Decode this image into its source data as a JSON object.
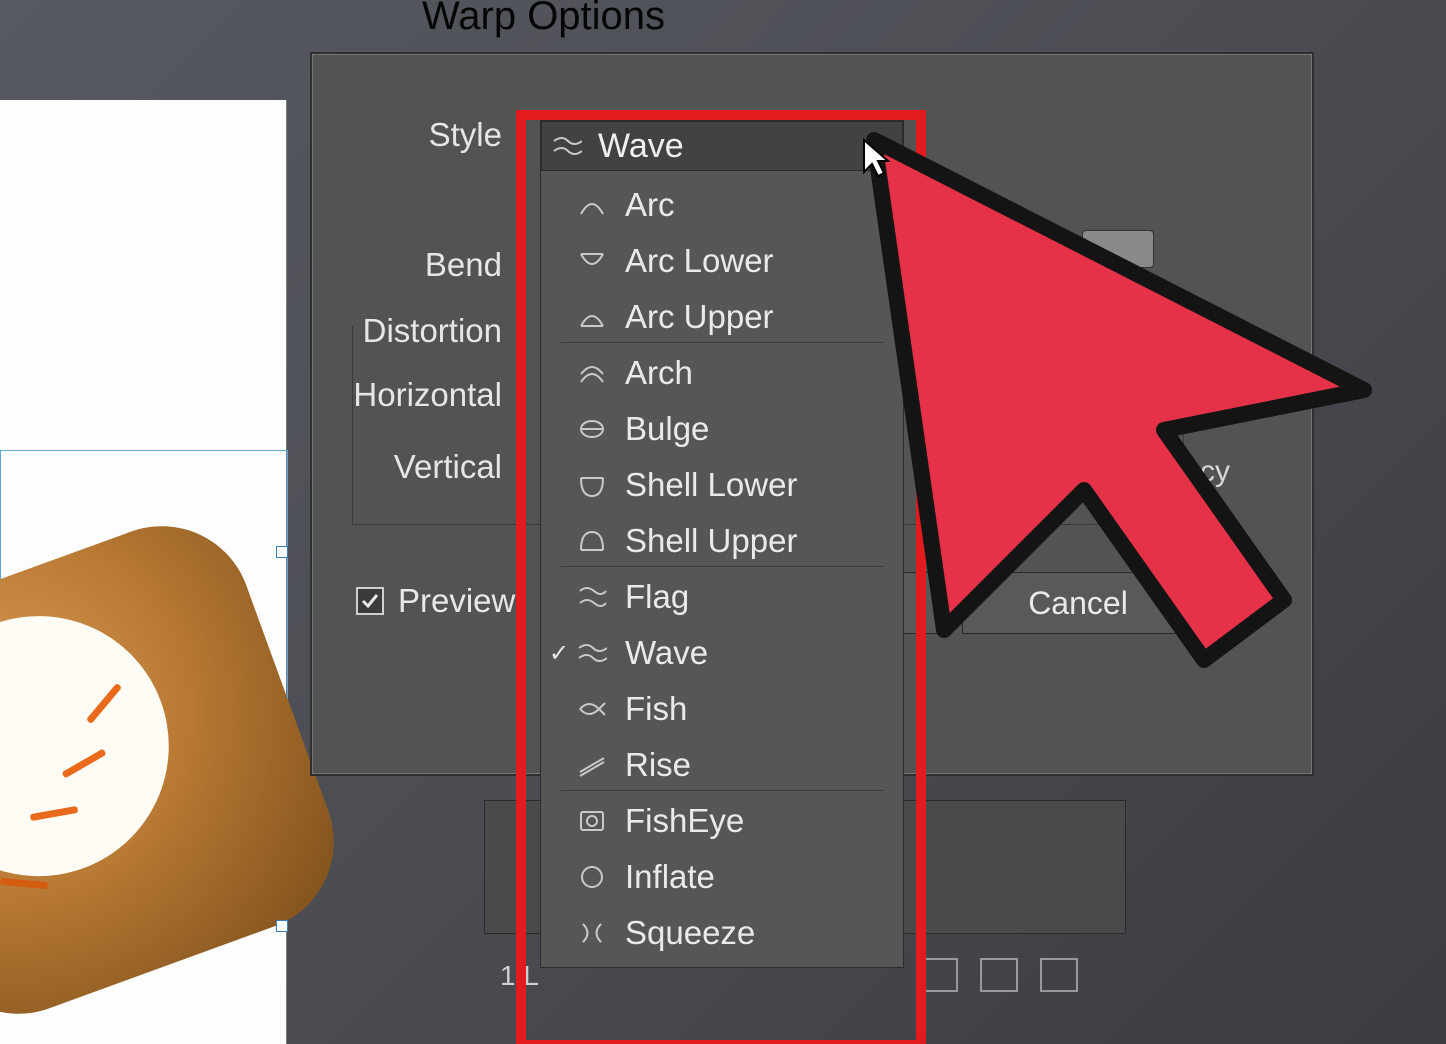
{
  "dialog": {
    "title": "Warp Options",
    "labels": {
      "style": "Style",
      "bend": "Bend",
      "distortion": "Distortion",
      "horizontal": "Horizontal",
      "vertical": "Vertical",
      "preview": "Preview"
    },
    "preview_checked": true,
    "buttons": {
      "cancel": "Cancel"
    },
    "side_text": "cy"
  },
  "style_dropdown": {
    "selected": "Wave",
    "groups": [
      [
        {
          "label": "Arc",
          "icon": "arc"
        },
        {
          "label": "Arc Lower",
          "icon": "arc-lower"
        },
        {
          "label": "Arc Upper",
          "icon": "arc-upper"
        }
      ],
      [
        {
          "label": "Arch",
          "icon": "arch"
        },
        {
          "label": "Bulge",
          "icon": "bulge"
        },
        {
          "label": "Shell Lower",
          "icon": "shell-lower"
        },
        {
          "label": "Shell Upper",
          "icon": "shell-upper"
        }
      ],
      [
        {
          "label": "Flag",
          "icon": "flag"
        },
        {
          "label": "Wave",
          "icon": "wave",
          "checked": true
        },
        {
          "label": "Fish",
          "icon": "fish"
        },
        {
          "label": "Rise",
          "icon": "rise"
        }
      ],
      [
        {
          "label": "FishEye",
          "icon": "fisheye"
        },
        {
          "label": "Inflate",
          "icon": "inflate"
        },
        {
          "label": "Squeeze",
          "icon": "squeeze"
        }
      ]
    ]
  },
  "layers_panel": {
    "status": "1 L"
  },
  "colors": {
    "highlight": "#e21c1c",
    "cursor": "#e63248"
  }
}
